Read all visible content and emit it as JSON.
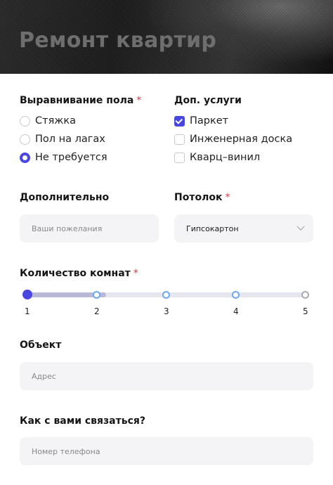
{
  "hero": {
    "title": "Ремонт квартир"
  },
  "floor": {
    "label": "Выравнивание пола",
    "required_mark": "*",
    "options": [
      "Стяжка",
      "Пол на лагах",
      "Не требуется"
    ],
    "selected": "Не требуется"
  },
  "extras": {
    "label": "Доп. услуги",
    "options": [
      "Паркет",
      "Инженерная доска",
      "Кварц–винил"
    ],
    "checked": [
      "Паркет"
    ]
  },
  "additional": {
    "label": "Дополнительно",
    "placeholder": "Ваши пожелания"
  },
  "ceiling": {
    "label": "Потолок",
    "required_mark": "*",
    "value": "Гипсокартон"
  },
  "rooms": {
    "label": "Количество комнат",
    "required_mark": "*",
    "ticks": [
      "1",
      "2",
      "3",
      "4",
      "5"
    ],
    "value": 1
  },
  "object": {
    "label": "Объект",
    "placeholder": "Адрес"
  },
  "contact": {
    "label": "Как с вами связаться?",
    "placeholder": "Номер телефона"
  },
  "colors": {
    "accent": "#4a46e0",
    "required": "#e0353b",
    "field_bg": "#f4f4f7"
  }
}
